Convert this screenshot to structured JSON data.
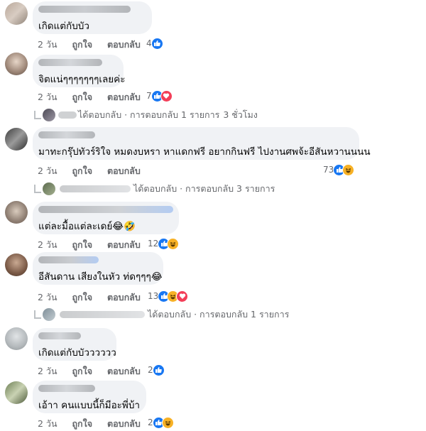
{
  "colors": {
    "accent": "#1877f2",
    "love": "#f33e58",
    "haha": "#f7b125",
    "bubble": "#f0f2f5",
    "meta": "#65676b"
  },
  "actions": {
    "like": "ถูกใจ",
    "reply": "ตอบกลับ"
  },
  "comments": [
    {
      "time": "2 วัน",
      "text": "เกิดแต่กับบัว",
      "reaction_count": "4",
      "reactions": [
        "like"
      ]
    },
    {
      "time": "2 วัน",
      "text": "จิตแน่ๆๆๆๆๆๆๆเลยค่ะ",
      "reaction_count": "7",
      "reactions": [
        "like",
        "love"
      ],
      "replies_label": "ได้ตอบกลับ · การตอบกลับ 1 รายการ",
      "replies_time": "3 ชั่วโมง"
    },
    {
      "time": "2 วัน",
      "text": "มาทะกรุ๊ปทัวร์ริใจ หมดงบหรา หาแดกฟรี อยากกินฟรี ไปงานศพจ้ะอีสันหวานนนน",
      "reaction_count": "73",
      "reactions": [
        "like",
        "haha"
      ],
      "replies_label": "ได้ตอบกลับ · การตอบกลับ 3 รายการ"
    },
    {
      "time": "2 วัน",
      "text": "แต่ละมื้อแต่ละเดย์",
      "text_emoji": "😂🤣",
      "reaction_count": "12",
      "reactions": [
        "like",
        "haha"
      ]
    },
    {
      "time": "2 วัน",
      "text": "อีสันดาน เสียงในหัว ท่ดๆๆๆ",
      "text_emoji": "😂",
      "reaction_count": "13",
      "reactions": [
        "like",
        "haha",
        "love"
      ],
      "replies_label": "ได้ตอบกลับ · การตอบกลับ 1 รายการ"
    },
    {
      "time": "2 วัน",
      "text": "เกิดแต่กับบัวววววว",
      "reaction_count": "2",
      "reactions": [
        "like"
      ]
    },
    {
      "time": "2 วัน",
      "text": "เอ้าา คนแบบนี้ก็มีอะพี่บ้า",
      "reaction_count": "2",
      "reactions": [
        "like",
        "haha"
      ]
    }
  ]
}
